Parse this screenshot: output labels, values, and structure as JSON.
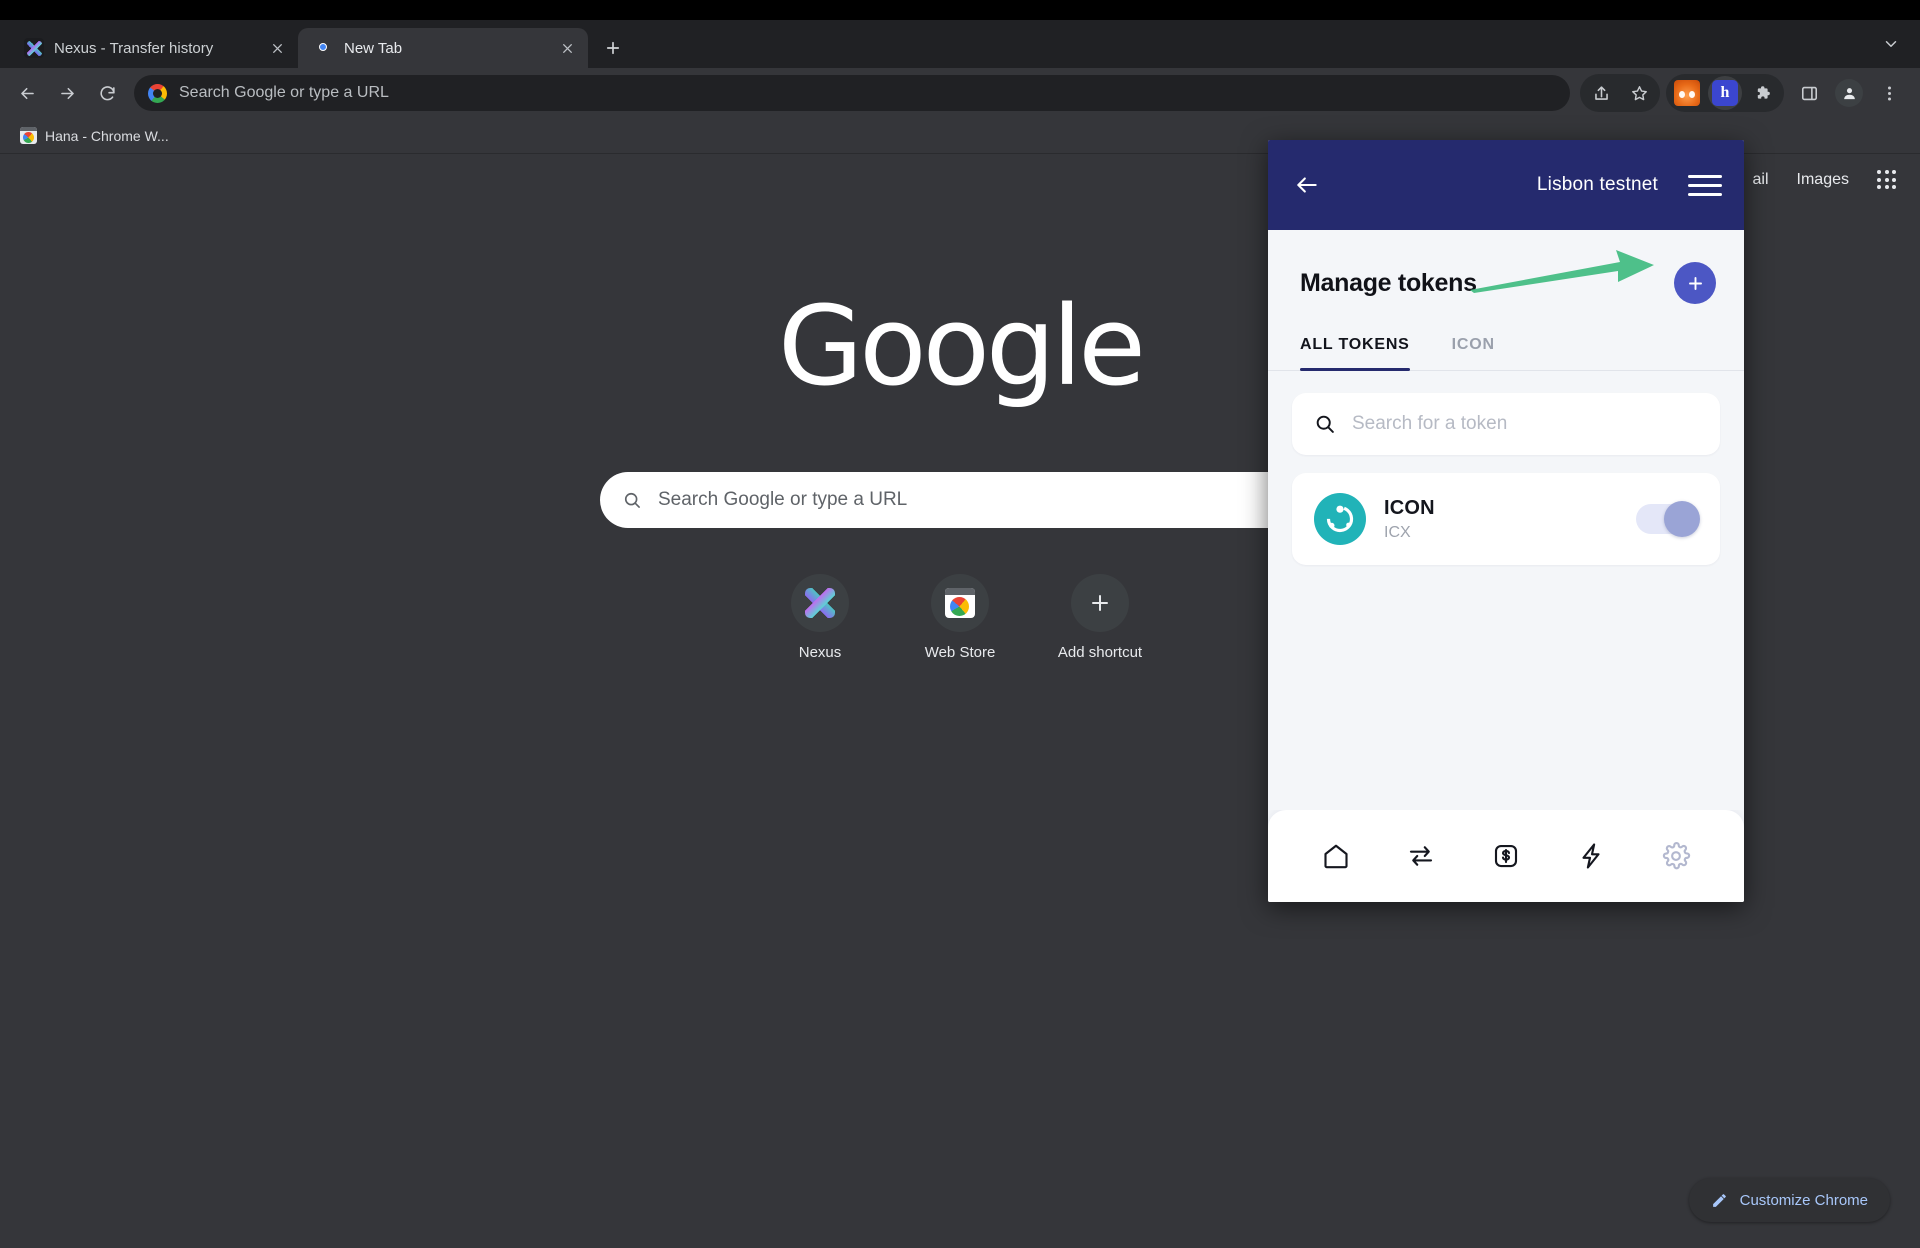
{
  "browser": {
    "tabs": [
      {
        "title": "Nexus - Transfer history",
        "favicon": "nexus-icon",
        "active": false,
        "close_label": "Close tab"
      },
      {
        "title": "New Tab",
        "favicon": "chrome-icon",
        "active": true,
        "close_label": "Close tab"
      }
    ],
    "new_tab_button_label": "New tab",
    "tab_list_chevron": "chevron-down-icon",
    "toolbar": {
      "back_label": "Back",
      "forward_label": "Forward",
      "reload_label": "Reload",
      "omnibox_placeholder": "Search Google or type a URL",
      "share_label": "Share this page",
      "bookmark_label": "Bookmark this tab",
      "extensions": [
        {
          "name": "MetaMask",
          "badge": ""
        },
        {
          "name": "Hana Wallet",
          "badge": "h"
        }
      ],
      "extensions_menu_label": "Extensions",
      "side_panel_label": "Side panel",
      "profile_label": "Profile",
      "menu_label": "Customize and control Google Chrome"
    },
    "bookmarks": [
      {
        "label": "Hana - Chrome W...",
        "icon": "chrome-webstore-icon"
      }
    ]
  },
  "newtab": {
    "top_links": [
      "ail",
      "Images"
    ],
    "apps_label": "Google apps",
    "logo_text": "Google",
    "search_placeholder": "Search Google or type a URL",
    "shortcuts": [
      {
        "label": "Nexus",
        "icon": "nexus-icon"
      },
      {
        "label": "Web Store",
        "icon": "chrome-webstore-icon"
      },
      {
        "label": "Add shortcut",
        "icon": "plus-icon"
      }
    ],
    "customize_label": "Customize Chrome",
    "customize_icon": "pencil-icon"
  },
  "popup": {
    "header": {
      "back_icon": "arrow-left-icon",
      "network": "Lisbon testnet",
      "menu_icon": "hamburger-menu-icon",
      "bg_color": "#252a6e"
    },
    "manage": {
      "title": "Manage tokens",
      "add_button_icon": "plus-icon",
      "add_button_color": "#4c57c4",
      "annotation_arrow_color": "#4ec08a"
    },
    "tabs": [
      {
        "label": "ALL TOKENS",
        "active": true
      },
      {
        "label": "ICON",
        "active": false
      }
    ],
    "search": {
      "placeholder": "Search for a token",
      "icon": "search-icon"
    },
    "tokens": [
      {
        "name": "ICON",
        "symbol": "ICX",
        "logo_color": "#21b3b8",
        "enabled": true,
        "toggle_track_color": "#e4e7f8",
        "toggle_knob_color": "#9aa4d6"
      }
    ],
    "footer_nav": [
      {
        "icon": "home-icon",
        "label": "Home",
        "active": true
      },
      {
        "icon": "swap-icon",
        "label": "Swap",
        "active": true
      },
      {
        "icon": "dollar-box-icon",
        "label": "Earn",
        "active": true
      },
      {
        "icon": "bolt-icon",
        "label": "Activity",
        "active": true
      },
      {
        "icon": "gear-icon",
        "label": "Settings",
        "active": false
      }
    ]
  }
}
